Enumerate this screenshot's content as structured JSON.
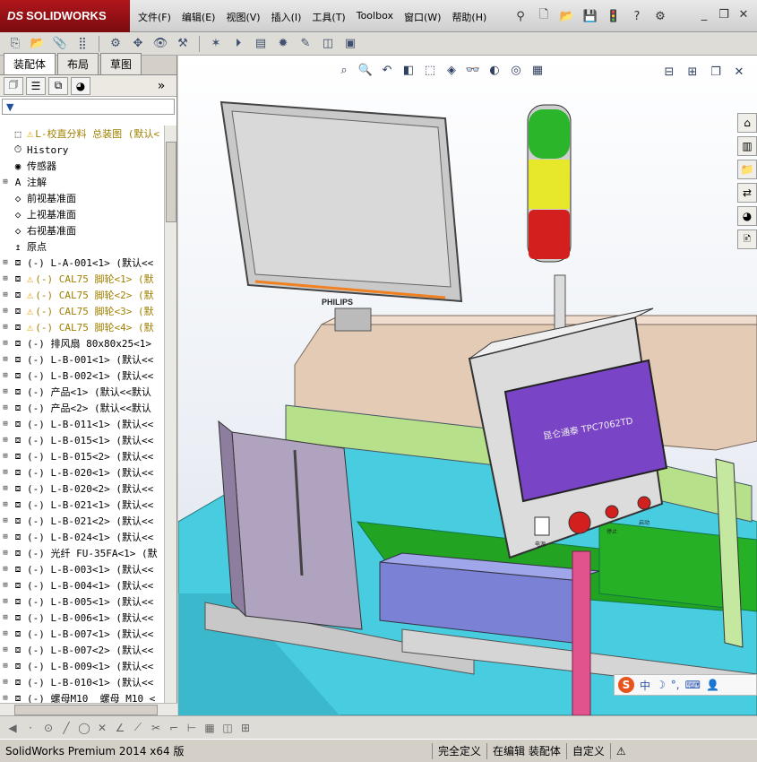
{
  "app": {
    "brand_prefix": "DS",
    "brand": "SOLIDWORKS"
  },
  "menu": [
    {
      "label": "文件(F)"
    },
    {
      "label": "编辑(E)"
    },
    {
      "label": "视图(V)"
    },
    {
      "label": "插入(I)"
    },
    {
      "label": "工具(T)"
    },
    {
      "label": "Toolbox"
    },
    {
      "label": "窗口(W)"
    },
    {
      "label": "帮助(H)"
    }
  ],
  "panel": {
    "tabs": [
      "装配体",
      "布局",
      "草图"
    ],
    "active_tab": "装配体"
  },
  "tree": [
    {
      "text": "L-校直分料 总装图 (默认<",
      "icon": "assembly-icon",
      "warn": true,
      "expand": "",
      "yellow": true
    },
    {
      "text": "History",
      "icon": "history-icon",
      "warn": false,
      "expand": "",
      "yellow": false
    },
    {
      "text": "传感器",
      "icon": "sensor-icon",
      "warn": false,
      "expand": "",
      "yellow": false
    },
    {
      "text": "注解",
      "icon": "annotation-icon",
      "warn": false,
      "expand": "+",
      "yellow": false
    },
    {
      "text": "前视基准面",
      "icon": "plane-icon",
      "warn": false,
      "expand": "",
      "yellow": false
    },
    {
      "text": "上视基准面",
      "icon": "plane-icon",
      "warn": false,
      "expand": "",
      "yellow": false
    },
    {
      "text": "右视基准面",
      "icon": "plane-icon",
      "warn": false,
      "expand": "",
      "yellow": false
    },
    {
      "text": "原点",
      "icon": "origin-icon",
      "warn": false,
      "expand": "",
      "yellow": false
    },
    {
      "text": "(-) L-A-001<1> (默认<<",
      "icon": "part-icon",
      "warn": false,
      "expand": "+",
      "yellow": false
    },
    {
      "text": "(-) CAL75 脚轮<1> (默",
      "icon": "part-icon",
      "warn": true,
      "expand": "+",
      "yellow": true
    },
    {
      "text": "(-) CAL75 脚轮<2> (默",
      "icon": "part-icon",
      "warn": true,
      "expand": "+",
      "yellow": true
    },
    {
      "text": "(-) CAL75 脚轮<3> (默",
      "icon": "part-icon",
      "warn": true,
      "expand": "+",
      "yellow": true
    },
    {
      "text": "(-) CAL75 脚轮<4> (默",
      "icon": "part-icon",
      "warn": true,
      "expand": "+",
      "yellow": true
    },
    {
      "text": "(-) 排风扇 80x80x25<1>",
      "icon": "part-icon",
      "warn": false,
      "expand": "+",
      "yellow": false
    },
    {
      "text": "(-) L-B-001<1> (默认<<",
      "icon": "part-icon",
      "warn": false,
      "expand": "+",
      "yellow": false
    },
    {
      "text": "(-) L-B-002<1> (默认<<",
      "icon": "part-icon",
      "warn": false,
      "expand": "+",
      "yellow": false
    },
    {
      "text": "(-) 产品<1> (默认<<默认",
      "icon": "part-icon",
      "warn": false,
      "expand": "+",
      "yellow": false
    },
    {
      "text": "(-) 产品<2> (默认<<默认",
      "icon": "part-icon",
      "warn": false,
      "expand": "+",
      "yellow": false
    },
    {
      "text": "(-) L-B-011<1> (默认<<",
      "icon": "part-icon",
      "warn": false,
      "expand": "+",
      "yellow": false
    },
    {
      "text": "(-) L-B-015<1> (默认<<",
      "icon": "part-icon",
      "warn": false,
      "expand": "+",
      "yellow": false
    },
    {
      "text": "(-) L-B-015<2> (默认<<",
      "icon": "part-icon",
      "warn": false,
      "expand": "+",
      "yellow": false
    },
    {
      "text": "(-) L-B-020<1> (默认<<",
      "icon": "part-icon",
      "warn": false,
      "expand": "+",
      "yellow": false
    },
    {
      "text": "(-) L-B-020<2> (默认<<",
      "icon": "part-icon",
      "warn": false,
      "expand": "+",
      "yellow": false
    },
    {
      "text": "(-) L-B-021<1> (默认<<",
      "icon": "part-icon",
      "warn": false,
      "expand": "+",
      "yellow": false
    },
    {
      "text": "(-) L-B-021<2> (默认<<",
      "icon": "part-icon",
      "warn": false,
      "expand": "+",
      "yellow": false
    },
    {
      "text": "(-) L-B-024<1> (默认<<",
      "icon": "part-icon",
      "warn": false,
      "expand": "+",
      "yellow": false
    },
    {
      "text": "(-) 光纤 FU-35FA<1> (默",
      "icon": "part-icon",
      "warn": false,
      "expand": "+",
      "yellow": false
    },
    {
      "text": "(-) L-B-003<1> (默认<<",
      "icon": "part-icon",
      "warn": false,
      "expand": "+",
      "yellow": false
    },
    {
      "text": "(-) L-B-004<1> (默认<<",
      "icon": "part-icon",
      "warn": false,
      "expand": "+",
      "yellow": false
    },
    {
      "text": "(-) L-B-005<1> (默认<<",
      "icon": "part-icon",
      "warn": false,
      "expand": "+",
      "yellow": false
    },
    {
      "text": "(-) L-B-006<1> (默认<<",
      "icon": "part-icon",
      "warn": false,
      "expand": "+",
      "yellow": false
    },
    {
      "text": "(-) L-B-007<1> (默认<<",
      "icon": "part-icon",
      "warn": false,
      "expand": "+",
      "yellow": false
    },
    {
      "text": "(-) L-B-007<2> (默认<<",
      "icon": "part-icon",
      "warn": false,
      "expand": "+",
      "yellow": false
    },
    {
      "text": "(-) L-B-009<1> (默认<<",
      "icon": "part-icon",
      "warn": false,
      "expand": "+",
      "yellow": false
    },
    {
      "text": "(-) L-B-010<1> (默认<<",
      "icon": "part-icon",
      "warn": false,
      "expand": "+",
      "yellow": false
    },
    {
      "text": "(-) 螺母M10_ 螺母 M10 <",
      "icon": "part-icon",
      "warn": false,
      "expand": "+",
      "yellow": false
    }
  ],
  "model": {
    "monitor_brand": "PHILIPS",
    "hmi_text": "昆仑通泰 TPC7062TD",
    "btn_power": "电源",
    "btn_stop": "停止",
    "btn_start": "启动"
  },
  "ime": {
    "items": [
      "中",
      "☽",
      "°,"
    ]
  },
  "status": {
    "version": "SolidWorks Premium 2014 x64 版",
    "state": "完全定义",
    "mode": "在编辑 装配体",
    "custom": "自定义"
  },
  "colors": {
    "brand": "#b0161b",
    "floor": "#4dd0e1",
    "hmi_screen": "#6a2ab0",
    "lamp_green": "#2bb52b",
    "lamp_yellow": "#e8e82a",
    "lamp_red": "#d41f1f"
  }
}
